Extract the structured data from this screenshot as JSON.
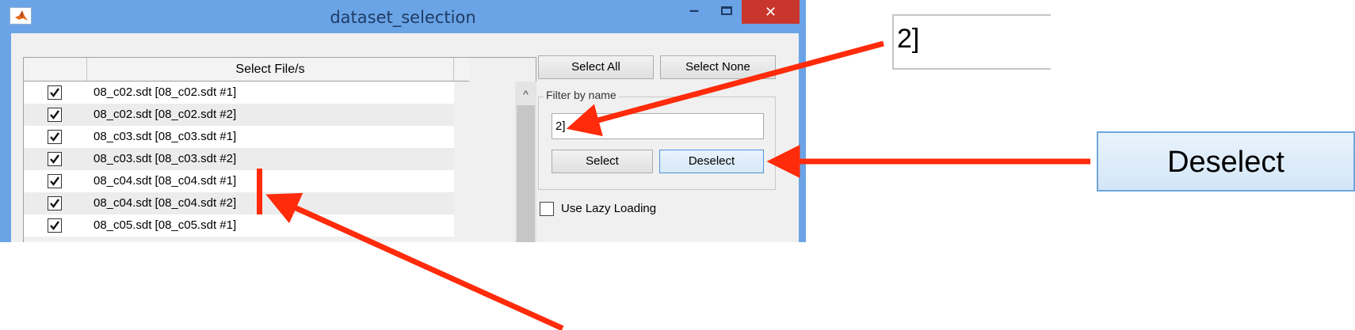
{
  "window": {
    "title": "dataset_selection",
    "minimize_glyph": "–",
    "close_glyph": "✕",
    "app_icon": "matlab-icon"
  },
  "table": {
    "header_file_col": "Select File/s",
    "rows": [
      {
        "checked": true,
        "label": "08_c02.sdt [08_c02.sdt #1]"
      },
      {
        "checked": true,
        "label": "08_c02.sdt [08_c02.sdt #2]"
      },
      {
        "checked": true,
        "label": "08_c03.sdt [08_c03.sdt #1]"
      },
      {
        "checked": true,
        "label": "08_c03.sdt [08_c03.sdt #2]"
      },
      {
        "checked": true,
        "label": "08_c04.sdt [08_c04.sdt #1]"
      },
      {
        "checked": true,
        "label": "08_c04.sdt [08_c04.sdt #2]"
      },
      {
        "checked": true,
        "label": "08_c05.sdt [08_c05.sdt #1]"
      }
    ],
    "scroll_up_glyph": "^"
  },
  "buttons": {
    "select_all": "Select All",
    "select_none": "Select None",
    "select": "Select",
    "deselect": "Deselect"
  },
  "filter": {
    "group_label": "Filter by name",
    "value": "2]"
  },
  "lazy_loading": {
    "label": "Use Lazy Loading",
    "checked": false
  },
  "zoom": {
    "filter_value": "2]",
    "deselect_label": "Deselect"
  },
  "colors": {
    "window_frame": "#6aa4e6",
    "close_button": "#c9362b",
    "annotation_arrow": "#ff2b0a",
    "deselect_highlight": "#d6e8f8"
  }
}
